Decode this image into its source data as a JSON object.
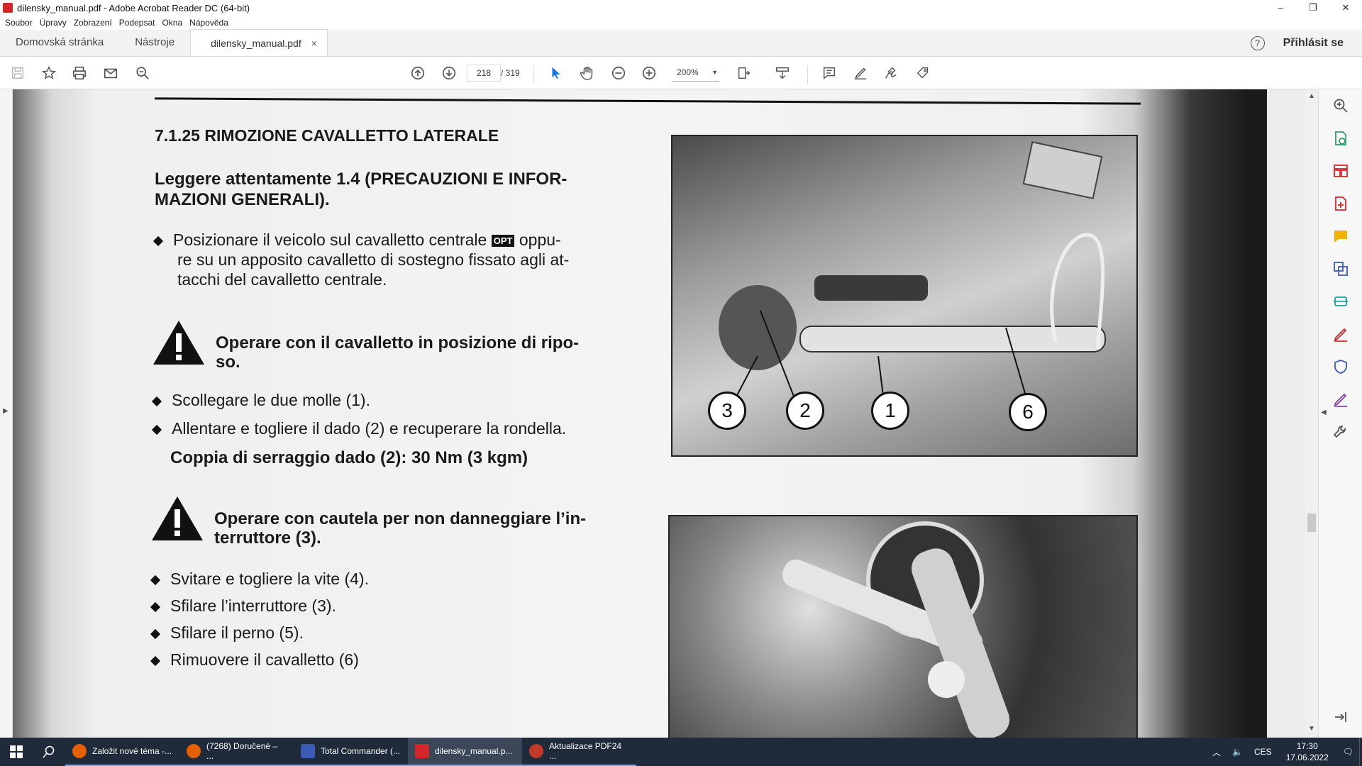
{
  "window": {
    "title": "dilensky_manual.pdf - Adobe Acrobat Reader DC (64-bit)",
    "controls": [
      "–",
      "❐",
      "✕"
    ]
  },
  "menu": [
    "Soubor",
    "Úpravy",
    "Zobrazení",
    "Podepsat",
    "Okna",
    "Nápověda"
  ],
  "tabs": {
    "home": "Domovská stránka",
    "tools": "Nástroje",
    "document": "dilensky_manual.pdf",
    "close": "×",
    "help": "?",
    "signin": "Přihlásit se"
  },
  "toolbar": {
    "page_current": "218",
    "page_total": "/ 319",
    "zoom": "200%",
    "icons": [
      "save-icon",
      "bookmark-icon",
      "print-icon",
      "email-icon",
      "find-icon",
      "prev-page-icon",
      "next-page-icon",
      "select-icon",
      "hand-icon",
      "zoom-out-icon",
      "zoom-in-icon",
      "fit-icon",
      "scroll-icon",
      "comment-icon",
      "highlight-icon",
      "sign-icon",
      "share-icon"
    ]
  },
  "document": {
    "section_title": "7.1.25  RIMOZIONE CAVALLETTO LATERALE",
    "read_note": "Leggere attentamente 1.4 (PRECAUZIONI E INFOR-\nMAZIONI GENERALI).",
    "step1_a": "Posizionare il veicolo sul cavalletto centrale",
    "opt_badge": "OPT",
    "step1_b": "oppu-",
    "step1_c": "re su un apposito cavalletto di sostegno fissato agli at-",
    "step1_d": "tacchi del cavalletto centrale.",
    "warning1_a": "Operare con il cavalletto in posizione di ripo-",
    "warning1_b": "so.",
    "step2": "Scollegare le due molle (1).",
    "step3": "Allentare e togliere il dado (2) e recuperare la rondella.",
    "torque": "Coppia di serraggio dado (2): 30 Nm (3 kgm)",
    "warning2_a": "Operare con cautela per non danneggiare l’in-",
    "warning2_b": "terruttore (3).",
    "step4": "Svitare e togliere la vite (4).",
    "step5": "Sfilare l’interruttore (3).",
    "step6": "Sfilare il perno (5).",
    "step7": "Rimuovere il cavalletto (6)",
    "callouts": [
      "3",
      "2",
      "1",
      "6"
    ]
  },
  "taskbar": {
    "apps": [
      {
        "label": "Založit nové téma -...",
        "color": "#e66000"
      },
      {
        "label": "(7268) Doručené – ...",
        "color": "#e66000"
      },
      {
        "label": "Total Commander (...",
        "color": "#3b5bb5"
      },
      {
        "label": "dilensky_manual.p...",
        "color": "#d4262b"
      },
      {
        "label": "Aktualizace PDF24 ...",
        "color": "#c0392b"
      }
    ],
    "lang": "CES",
    "time": "17:30",
    "date": "17.06.2022"
  },
  "colors": {
    "acrobat_red": "#d4262b",
    "select_blue": "#1473e6",
    "taskbar": "#1f2a3a"
  }
}
